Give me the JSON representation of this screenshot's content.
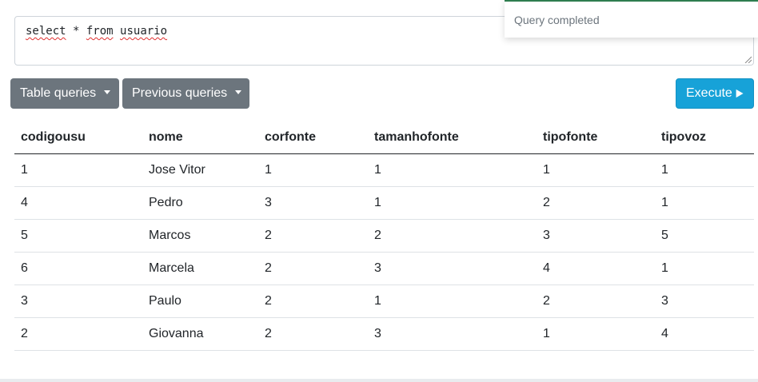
{
  "query": {
    "words": [
      {
        "text": "select",
        "misspelled": true
      },
      {
        "text": " * ",
        "misspelled": false
      },
      {
        "text": "from",
        "misspelled": true
      },
      {
        "text": " ",
        "misspelled": false
      },
      {
        "text": "usuario",
        "misspelled": true
      }
    ]
  },
  "toast": {
    "message": "Query completed",
    "accent_color": "#2e7d4f"
  },
  "toolbar": {
    "table_queries_label": "Table queries",
    "previous_queries_label": "Previous queries",
    "execute_label": "Execute",
    "execute_icon": "play-icon",
    "dropdown_icon": "caret-down-icon"
  },
  "results": {
    "columns": [
      "codigousu",
      "nome",
      "corfonte",
      "tamanhofonte",
      "tipofonte",
      "tipovoz"
    ],
    "rows": [
      [
        "1",
        "Jose Vitor",
        "1",
        "1",
        "1",
        "1"
      ],
      [
        "4",
        "Pedro",
        "3",
        "1",
        "2",
        "1"
      ],
      [
        "5",
        "Marcos",
        "2",
        "2",
        "3",
        "5"
      ],
      [
        "6",
        "Marcela",
        "2",
        "3",
        "4",
        "1"
      ],
      [
        "3",
        "Paulo",
        "2",
        "1",
        "2",
        "3"
      ],
      [
        "2",
        "Giovanna",
        "2",
        "3",
        "1",
        "4"
      ]
    ]
  },
  "colors": {
    "secondary_button": "#6c757d",
    "execute_button": "#17a2d8"
  }
}
